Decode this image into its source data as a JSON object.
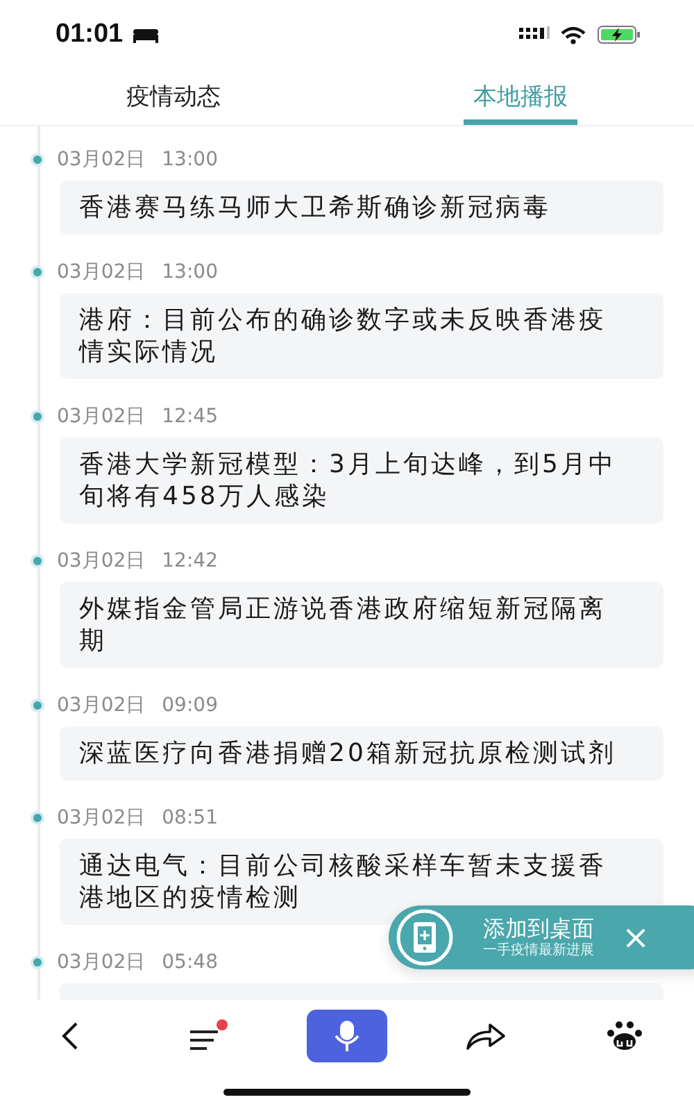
{
  "status_bar": {
    "time": "01:01"
  },
  "tabs": [
    {
      "label": "疫情动态",
      "selected": false
    },
    {
      "label": "本地播报",
      "selected": true
    }
  ],
  "timeline": [
    {
      "date": "03月02日",
      "time": "13:00",
      "title": "香港赛马练马师大卫希斯确诊新冠病毒"
    },
    {
      "date": "03月02日",
      "time": "13:00",
      "title": "港府：目前公布的确诊数字或未反映香港疫情实际情况"
    },
    {
      "date": "03月02日",
      "time": "12:45",
      "title": "香港大学新冠模型：3月上旬达峰，到5月中旬将有458万人感染"
    },
    {
      "date": "03月02日",
      "time": "12:42",
      "title": "外媒指金管局正游说香港政府缩短新冠隔离期"
    },
    {
      "date": "03月02日",
      "time": "09:09",
      "title": "深蓝医疗向香港捐赠20箱新冠抗原检测试剂"
    },
    {
      "date": "03月02日",
      "time": "08:51",
      "title": "通达电气：目前公司核酸采样车暂未支援香港地区的疫情检测"
    },
    {
      "date": "03月02日",
      "time": "05:48"
    }
  ],
  "banner": {
    "title": "添加到桌面",
    "subtitle": "一手疫情最新进展",
    "close": "×"
  },
  "bottom_nav": [
    {
      "kind": "back"
    },
    {
      "kind": "menu",
      "badge": true
    },
    {
      "kind": "voice"
    },
    {
      "kind": "share"
    },
    {
      "kind": "paw"
    }
  ]
}
